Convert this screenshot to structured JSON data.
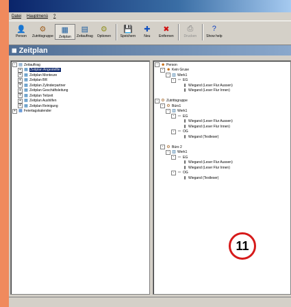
{
  "menu": [
    "Datei",
    "Hauptmenü",
    "?"
  ],
  "toolbar": [
    {
      "label": "Person",
      "icon": "person-icon",
      "glyph": "👤",
      "color": "#c06000"
    },
    {
      "label": "Zutrittsgruppe",
      "icon": "group-icon",
      "glyph": "⚙",
      "color": "#a06020"
    },
    {
      "label": "Zeitplan",
      "icon": "calendar-icon",
      "glyph": "▦",
      "color": "#2060a0",
      "active": true
    },
    {
      "label": "Zeitauftrag",
      "icon": "task-icon",
      "glyph": "▤",
      "color": "#2060a0"
    },
    {
      "label": "Optionen",
      "icon": "options-icon",
      "glyph": "⚙",
      "color": "#909020"
    },
    {
      "label": "Speichern",
      "icon": "save-icon",
      "glyph": "💾",
      "color": "#2050c0"
    },
    {
      "label": "Neu",
      "icon": "new-icon",
      "glyph": "✚",
      "color": "#1050c0"
    },
    {
      "label": "Entfernen",
      "icon": "remove-icon",
      "glyph": "✖",
      "color": "#d01010"
    },
    {
      "label": "Drucken",
      "icon": "print-icon",
      "glyph": "⎙",
      "color": "#808080",
      "disabled": true
    },
    {
      "label": "Show help",
      "icon": "help-icon",
      "glyph": "?",
      "color": "#1040c0"
    }
  ],
  "header": {
    "title": "Zeitplan"
  },
  "left_tree": [
    {
      "label": "Zeitauftrag",
      "depth": 0,
      "toggle": "-",
      "icon": "folder-icon"
    },
    {
      "label": "Zeitplan Angestellte",
      "depth": 1,
      "toggle": "+",
      "icon": "calendar-icon",
      "selected": true
    },
    {
      "label": "Zeitplan Monteure",
      "depth": 1,
      "toggle": "+",
      "icon": "calendar-icon"
    },
    {
      "label": "Zeitplan BR",
      "depth": 1,
      "toggle": "+",
      "icon": "calendar-icon"
    },
    {
      "label": "Zeitplan Zylinderpartner",
      "depth": 1,
      "toggle": "+",
      "icon": "calendar-icon"
    },
    {
      "label": "Zeitplan Geschäftsleitung",
      "depth": 1,
      "toggle": "+",
      "icon": "calendar-icon"
    },
    {
      "label": "Zeitplan Teilzeit",
      "depth": 1,
      "toggle": "+",
      "icon": "calendar-icon"
    },
    {
      "label": "Zeitplan Aushilfen",
      "depth": 1,
      "toggle": "+",
      "icon": "calendar-icon"
    },
    {
      "label": "Zeitplan Reinigung",
      "depth": 1,
      "toggle": "+",
      "icon": "calendar-icon"
    },
    {
      "label": "Feiertagskalender",
      "depth": 0,
      "toggle": "+",
      "icon": "holiday-icon"
    }
  ],
  "right_tree": [
    {
      "label": "Person",
      "depth": 0,
      "toggle": "-",
      "icon": "person-icon"
    },
    {
      "label": "Kein Gruse",
      "depth": 1,
      "toggle": "-",
      "icon": "person-icon"
    },
    {
      "label": "Werk1",
      "depth": 2,
      "toggle": "-",
      "icon": "building-icon"
    },
    {
      "label": "EG",
      "depth": 3,
      "toggle": "-",
      "icon": "floor-icon"
    },
    {
      "label": "Wiegand (Leser Flur Aussen)",
      "depth": 4,
      "toggle": "",
      "icon": "reader-icon"
    },
    {
      "label": "Wiegand (Leser Flur Innen)",
      "depth": 4,
      "toggle": "",
      "icon": "reader-icon"
    },
    {
      "label": "",
      "depth": 0,
      "toggle": "",
      "icon": ""
    },
    {
      "label": "Zutrittsgruppe",
      "depth": 0,
      "toggle": "-",
      "icon": "group-icon"
    },
    {
      "label": "Büro1",
      "depth": 1,
      "toggle": "-",
      "icon": "group-icon"
    },
    {
      "label": "Werk1",
      "depth": 2,
      "toggle": "-",
      "icon": "building-icon"
    },
    {
      "label": "EG",
      "depth": 3,
      "toggle": "-",
      "icon": "floor-icon"
    },
    {
      "label": "Wiegand (Leser Flur Aussen)",
      "depth": 4,
      "toggle": "",
      "icon": "reader-icon"
    },
    {
      "label": "Wiegand (Leser Flur Innen)",
      "depth": 4,
      "toggle": "",
      "icon": "reader-icon"
    },
    {
      "label": "OG",
      "depth": 3,
      "toggle": "-",
      "icon": "floor-icon"
    },
    {
      "label": "Wiegand (Testleser)",
      "depth": 4,
      "toggle": "",
      "icon": "reader-icon"
    },
    {
      "label": "",
      "depth": 0,
      "toggle": "",
      "icon": ""
    },
    {
      "label": "Büro 2",
      "depth": 1,
      "toggle": "-",
      "icon": "group-icon"
    },
    {
      "label": "Werk1",
      "depth": 2,
      "toggle": "-",
      "icon": "building-icon"
    },
    {
      "label": "EG",
      "depth": 3,
      "toggle": "-",
      "icon": "floor-icon"
    },
    {
      "label": "Wiegand (Leser Flur Aussen)",
      "depth": 4,
      "toggle": "",
      "icon": "reader-icon"
    },
    {
      "label": "Wiegand (Leser Flur Innen)",
      "depth": 4,
      "toggle": "",
      "icon": "reader-icon"
    },
    {
      "label": "OG",
      "depth": 3,
      "toggle": "-",
      "icon": "floor-icon"
    },
    {
      "label": "Wiegand (Testleser)",
      "depth": 4,
      "toggle": "",
      "icon": "reader-icon"
    }
  ],
  "badge": {
    "number": "11"
  }
}
